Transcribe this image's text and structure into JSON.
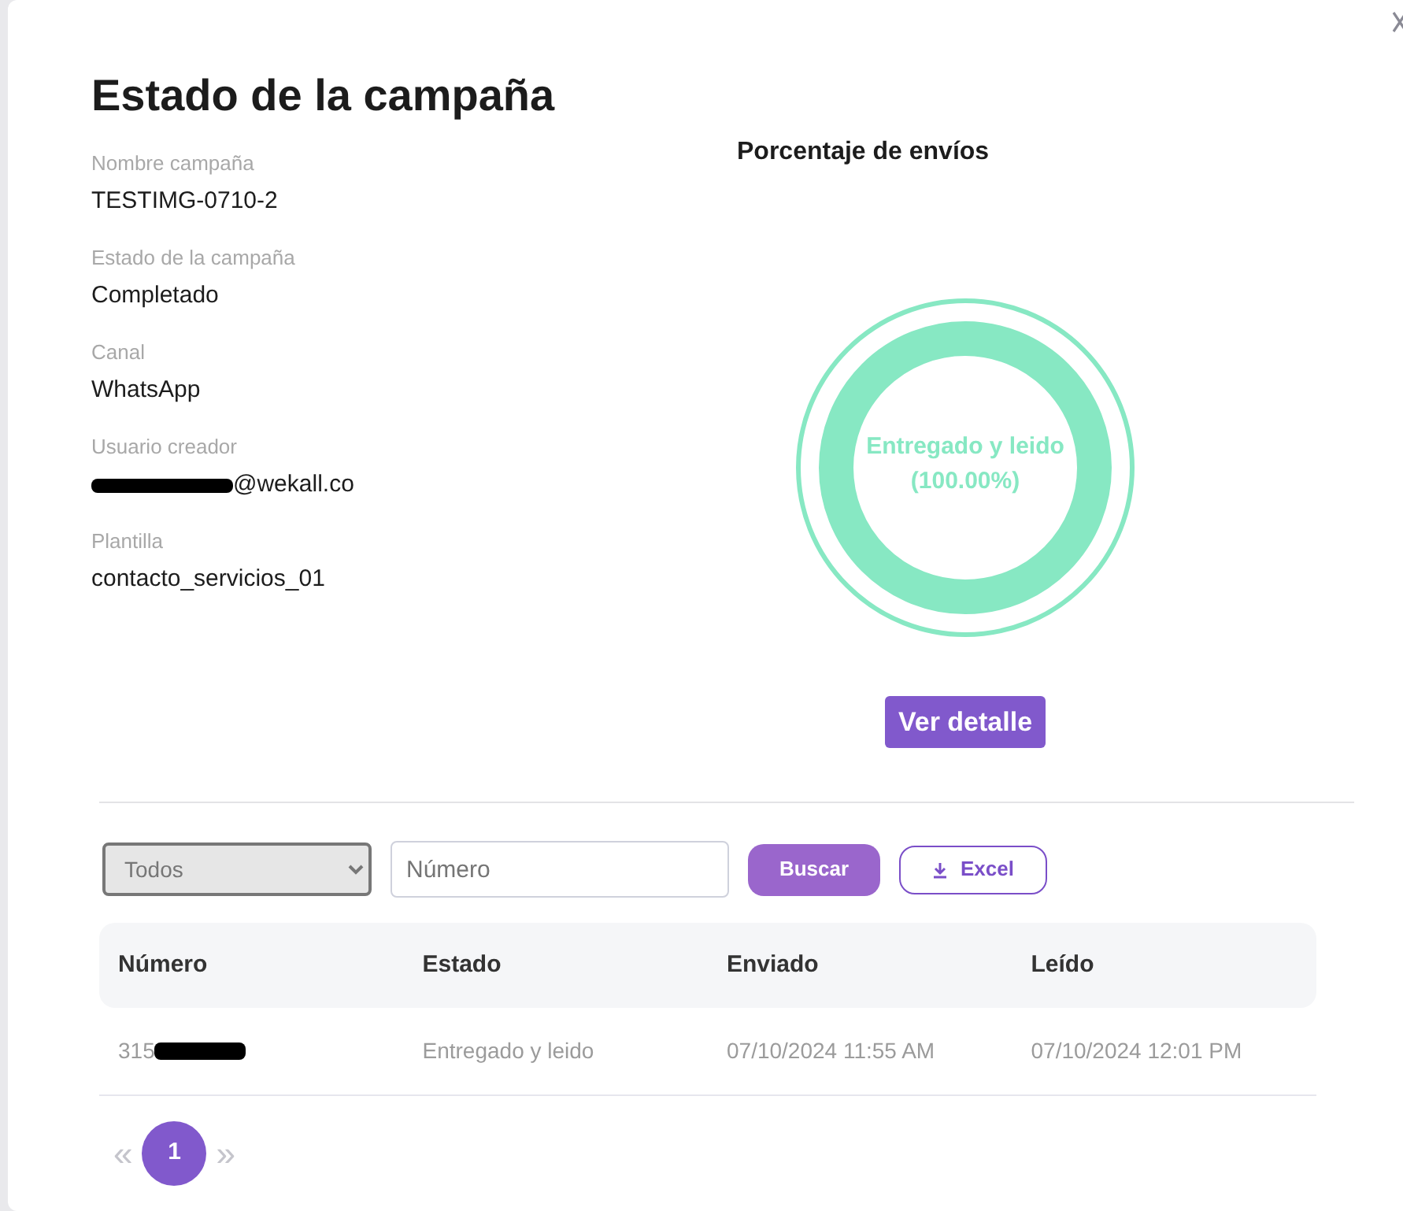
{
  "title": "Estado de la campaña",
  "fields": [
    {
      "label": "Nombre campaña",
      "value": "TESTIMG-0710-2",
      "redacted": false
    },
    {
      "label": "Estado de la campaña",
      "value": "Completado",
      "redacted": false
    },
    {
      "label": "Canal",
      "value": "WhatsApp",
      "redacted": false
    },
    {
      "label": "Usuario creador",
      "value": "@wekall.co",
      "redacted": true
    },
    {
      "label": "Plantilla",
      "value": "contacto_servicios_01",
      "redacted": false
    }
  ],
  "chart": {
    "title": "Porcentaje de envíos",
    "center_label": "Entregado y leido",
    "center_value": "(100.00%)"
  },
  "detail_button": "Ver detalle",
  "filter": {
    "value": "Todos"
  },
  "search": {
    "placeholder": "Número"
  },
  "search_button": "Buscar",
  "excel_button": "Excel",
  "table": {
    "columns": [
      "Número",
      "Estado",
      "Enviado",
      "Leído"
    ],
    "rows": [
      {
        "cells": [
          "315",
          "Entregado y leido",
          "07/10/2024 11:55 AM",
          "07/10/2024 12:01 PM"
        ],
        "redacted": true
      }
    ]
  },
  "pagination": {
    "prev": "«",
    "next": "»",
    "pages": [
      {
        "label": "1",
        "selected": true
      }
    ]
  }
}
